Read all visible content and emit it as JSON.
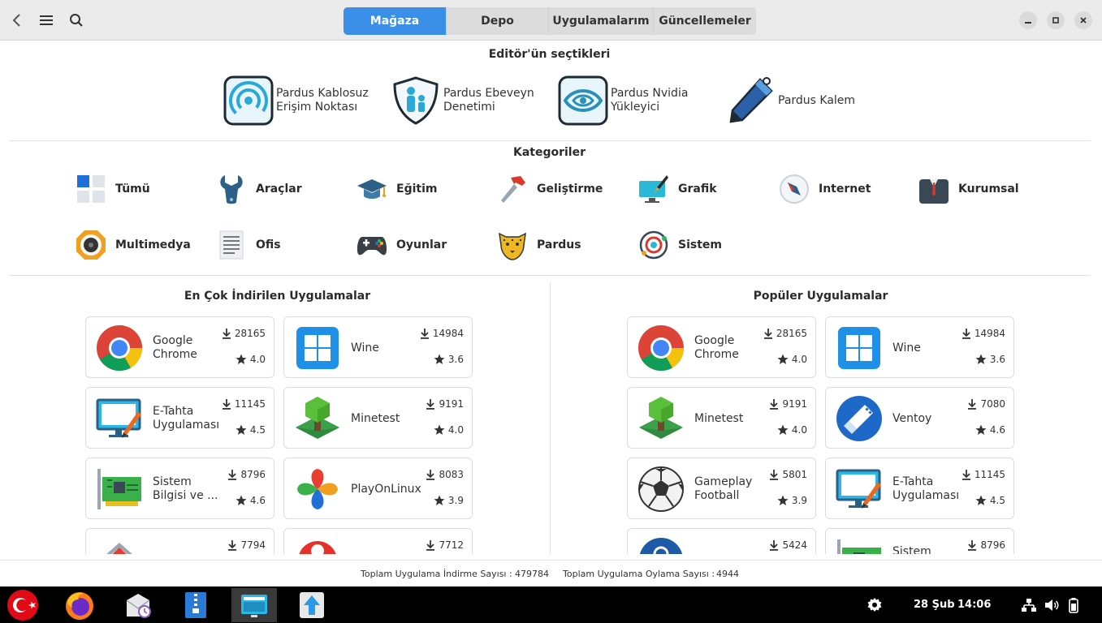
{
  "header": {
    "tabs": [
      {
        "label": "Mağaza",
        "active": true
      },
      {
        "label": "Depo",
        "active": false
      },
      {
        "label": "Uygulamalarım",
        "active": false
      },
      {
        "label": "Güncellemeler",
        "active": false
      }
    ],
    "accent": "#3a8fe8"
  },
  "editor": {
    "title": "Editör'ün seçtikleri",
    "items": [
      {
        "label": "Pardus Kablosuz\nErişim Noktası",
        "icon": "wifi-hotspot-icon"
      },
      {
        "label": "Pardus Ebeveyn\nDenetimi",
        "icon": "parental-shield-icon"
      },
      {
        "label": "Pardus Nvidia\nYükleyici",
        "icon": "nvidia-eye-icon"
      },
      {
        "label": "Pardus Kalem",
        "icon": "pen-icon"
      }
    ]
  },
  "categories": {
    "title": "Kategoriler",
    "items": [
      {
        "label": "Tümü",
        "icon": "grid-icon"
      },
      {
        "label": "Araçlar",
        "icon": "wrench-icon"
      },
      {
        "label": "Eğitim",
        "icon": "graduation-cap-icon"
      },
      {
        "label": "Geliştirme",
        "icon": "hammer-icon"
      },
      {
        "label": "Grafik",
        "icon": "paint-monitor-icon"
      },
      {
        "label": "Internet",
        "icon": "compass-icon"
      },
      {
        "label": "Kurumsal",
        "icon": "suit-icon"
      },
      {
        "label": "Multimedya",
        "icon": "speaker-icon"
      },
      {
        "label": "Ofis",
        "icon": "document-icon"
      },
      {
        "label": "Oyunlar",
        "icon": "gamepad-icon"
      },
      {
        "label": "Pardus",
        "icon": "leopard-icon"
      },
      {
        "label": "Sistem",
        "icon": "system-ring-icon"
      }
    ]
  },
  "most_downloaded": {
    "title": "En Çok İndirilen Uygulamalar",
    "apps": [
      {
        "name": "Google\nChrome",
        "downloads": "28165",
        "rating": "4.0",
        "icon": "chrome-icon"
      },
      {
        "name": "Wine",
        "downloads": "14984",
        "rating": "3.6",
        "icon": "windows-icon"
      },
      {
        "name": "E-Tahta\nUygulaması",
        "downloads": "11145",
        "rating": "4.5",
        "icon": "etahta-icon"
      },
      {
        "name": "Minetest",
        "downloads": "9191",
        "rating": "4.0",
        "icon": "minetest-icon"
      },
      {
        "name": "Sistem\nBilgisi ve ...",
        "downloads": "8796",
        "rating": "4.6",
        "icon": "circuit-board-icon"
      },
      {
        "name": "PlayOnLinux",
        "downloads": "8083",
        "rating": "3.9",
        "icon": "playonlinux-icon"
      },
      {
        "name": "",
        "downloads": "7794",
        "rating": "",
        "icon": "red-roof-icon"
      },
      {
        "name": "",
        "downloads": "7712",
        "rating": "",
        "icon": "red-mushroom-icon"
      }
    ]
  },
  "popular": {
    "title": "Popüler Uygulamalar",
    "apps": [
      {
        "name": "Google\nChrome",
        "downloads": "28165",
        "rating": "4.0",
        "icon": "chrome-icon"
      },
      {
        "name": "Wine",
        "downloads": "14984",
        "rating": "3.6",
        "icon": "windows-icon"
      },
      {
        "name": "Minetest",
        "downloads": "9191",
        "rating": "4.0",
        "icon": "minetest-icon"
      },
      {
        "name": "Ventoy",
        "downloads": "7080",
        "rating": "4.6",
        "icon": "usb-drive-icon"
      },
      {
        "name": "Gameplay\nFootball",
        "downloads": "5801",
        "rating": "3.9",
        "icon": "football-icon"
      },
      {
        "name": "E-Tahta\nUygulaması",
        "downloads": "11145",
        "rating": "4.5",
        "icon": "etahta-icon"
      },
      {
        "name": "",
        "downloads": "5424",
        "rating": "",
        "icon": "blue-circle-icon"
      },
      {
        "name": "Sistem",
        "downloads": "8796",
        "rating": "",
        "icon": "circuit-board-icon"
      }
    ]
  },
  "status": {
    "downloads_label": "Toplam Uygulama İndirme Sayısı :",
    "downloads_value": "479784",
    "ratings_label": "Toplam Uygulama Oylama Sayısı :",
    "ratings_value": "4944"
  },
  "taskbar": {
    "date": "28 Şub",
    "time": "14:06"
  }
}
